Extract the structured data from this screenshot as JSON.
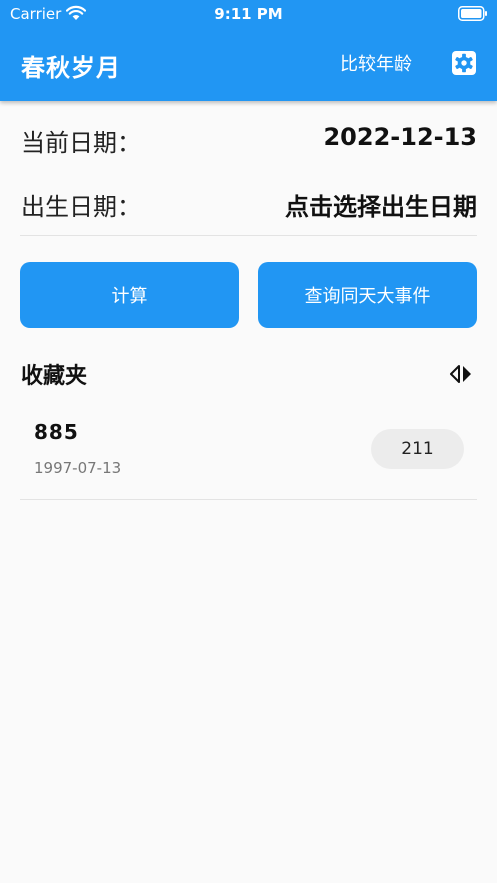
{
  "status_bar": {
    "carrier": "Carrier",
    "time": "9:11 PM"
  },
  "app_bar": {
    "title": "春秋岁月",
    "compare_label": "比较年龄"
  },
  "current_date": {
    "label": "当前日期：",
    "value": "2022-12-13"
  },
  "birth_date": {
    "label": "出生日期：",
    "value": "点击选择出生日期"
  },
  "buttons": {
    "calculate": "计算",
    "same_day_events": "查询同天大事件"
  },
  "favorites": {
    "title": "收藏夹",
    "items": [
      {
        "name": "885",
        "date": "1997-07-13",
        "badge": "211"
      }
    ]
  },
  "colors": {
    "primary": "#2196f3",
    "background": "#fafafa",
    "badge": "#ececec"
  }
}
